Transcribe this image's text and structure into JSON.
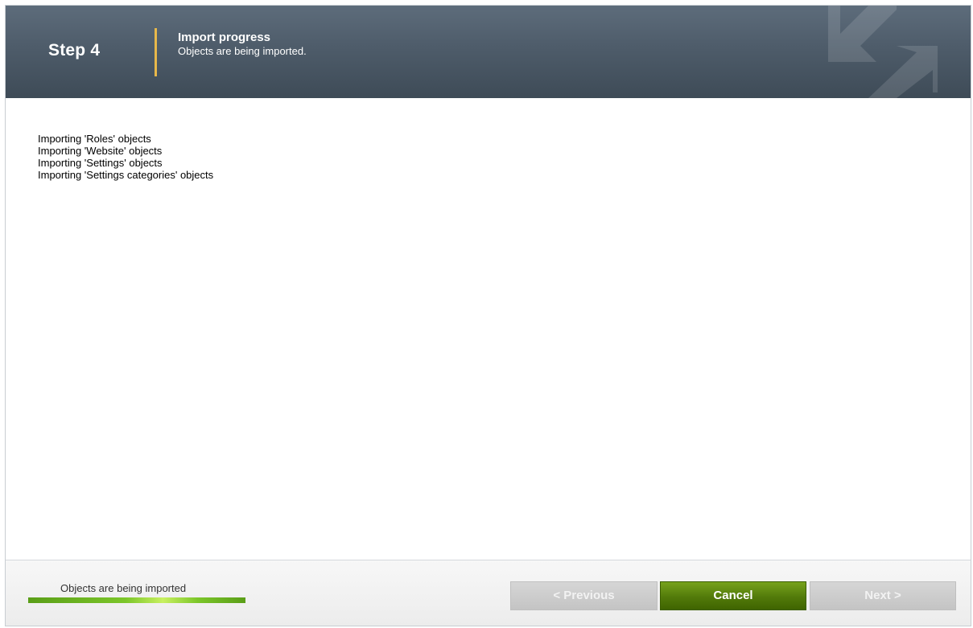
{
  "header": {
    "step": "Step 4",
    "title": "Import progress",
    "subtitle": "Objects are being imported."
  },
  "log": [
    "Importing 'Roles' objects",
    "Importing 'Website' objects",
    "Importing 'Settings' objects",
    "Importing 'Settings categories' objects"
  ],
  "footer": {
    "status": "Objects are being imported",
    "progress": 1.0,
    "buttons": {
      "previous": "< Previous",
      "cancel": "Cancel",
      "next": "Next >"
    }
  },
  "colors": {
    "header": "#4e5c6a",
    "accent_divider": "#e8b84a",
    "primary_button": "#527a0a",
    "progress": "#7cc62a"
  },
  "icons": {
    "header_decoration": "import-arrows-icon"
  }
}
